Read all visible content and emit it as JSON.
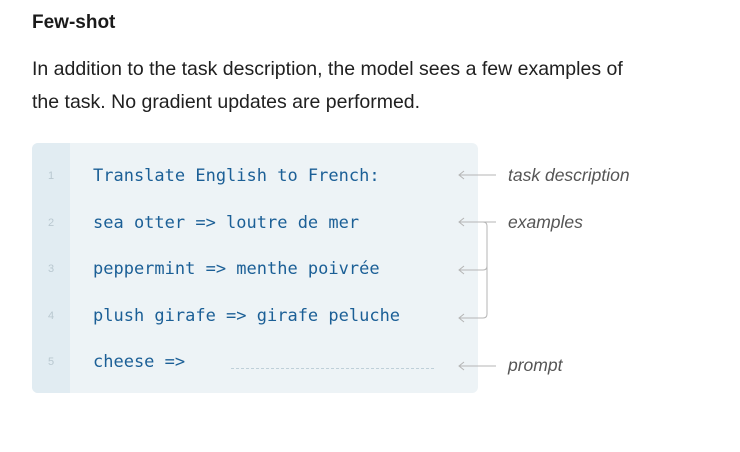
{
  "title": "Few-shot",
  "description": "In addition to the task description, the model sees a few examples of the task. No gradient updates are performed.",
  "code_lines": [
    {
      "num": "1",
      "text": "Translate English to French:"
    },
    {
      "num": "2",
      "text": "sea otter => loutre de mer"
    },
    {
      "num": "3",
      "text": "peppermint => menthe poivrée"
    },
    {
      "num": "4",
      "text": "plush girafe => girafe peluche"
    },
    {
      "num": "5",
      "text": "cheese =>"
    }
  ],
  "annotations": {
    "task_description": "task description",
    "examples": "examples",
    "prompt": "prompt"
  },
  "colors": {
    "code_text": "#1b5f96",
    "code_background": "#edf3f6",
    "gutter_background": "#e1ecf2",
    "arrow": "#b5b5b5"
  }
}
